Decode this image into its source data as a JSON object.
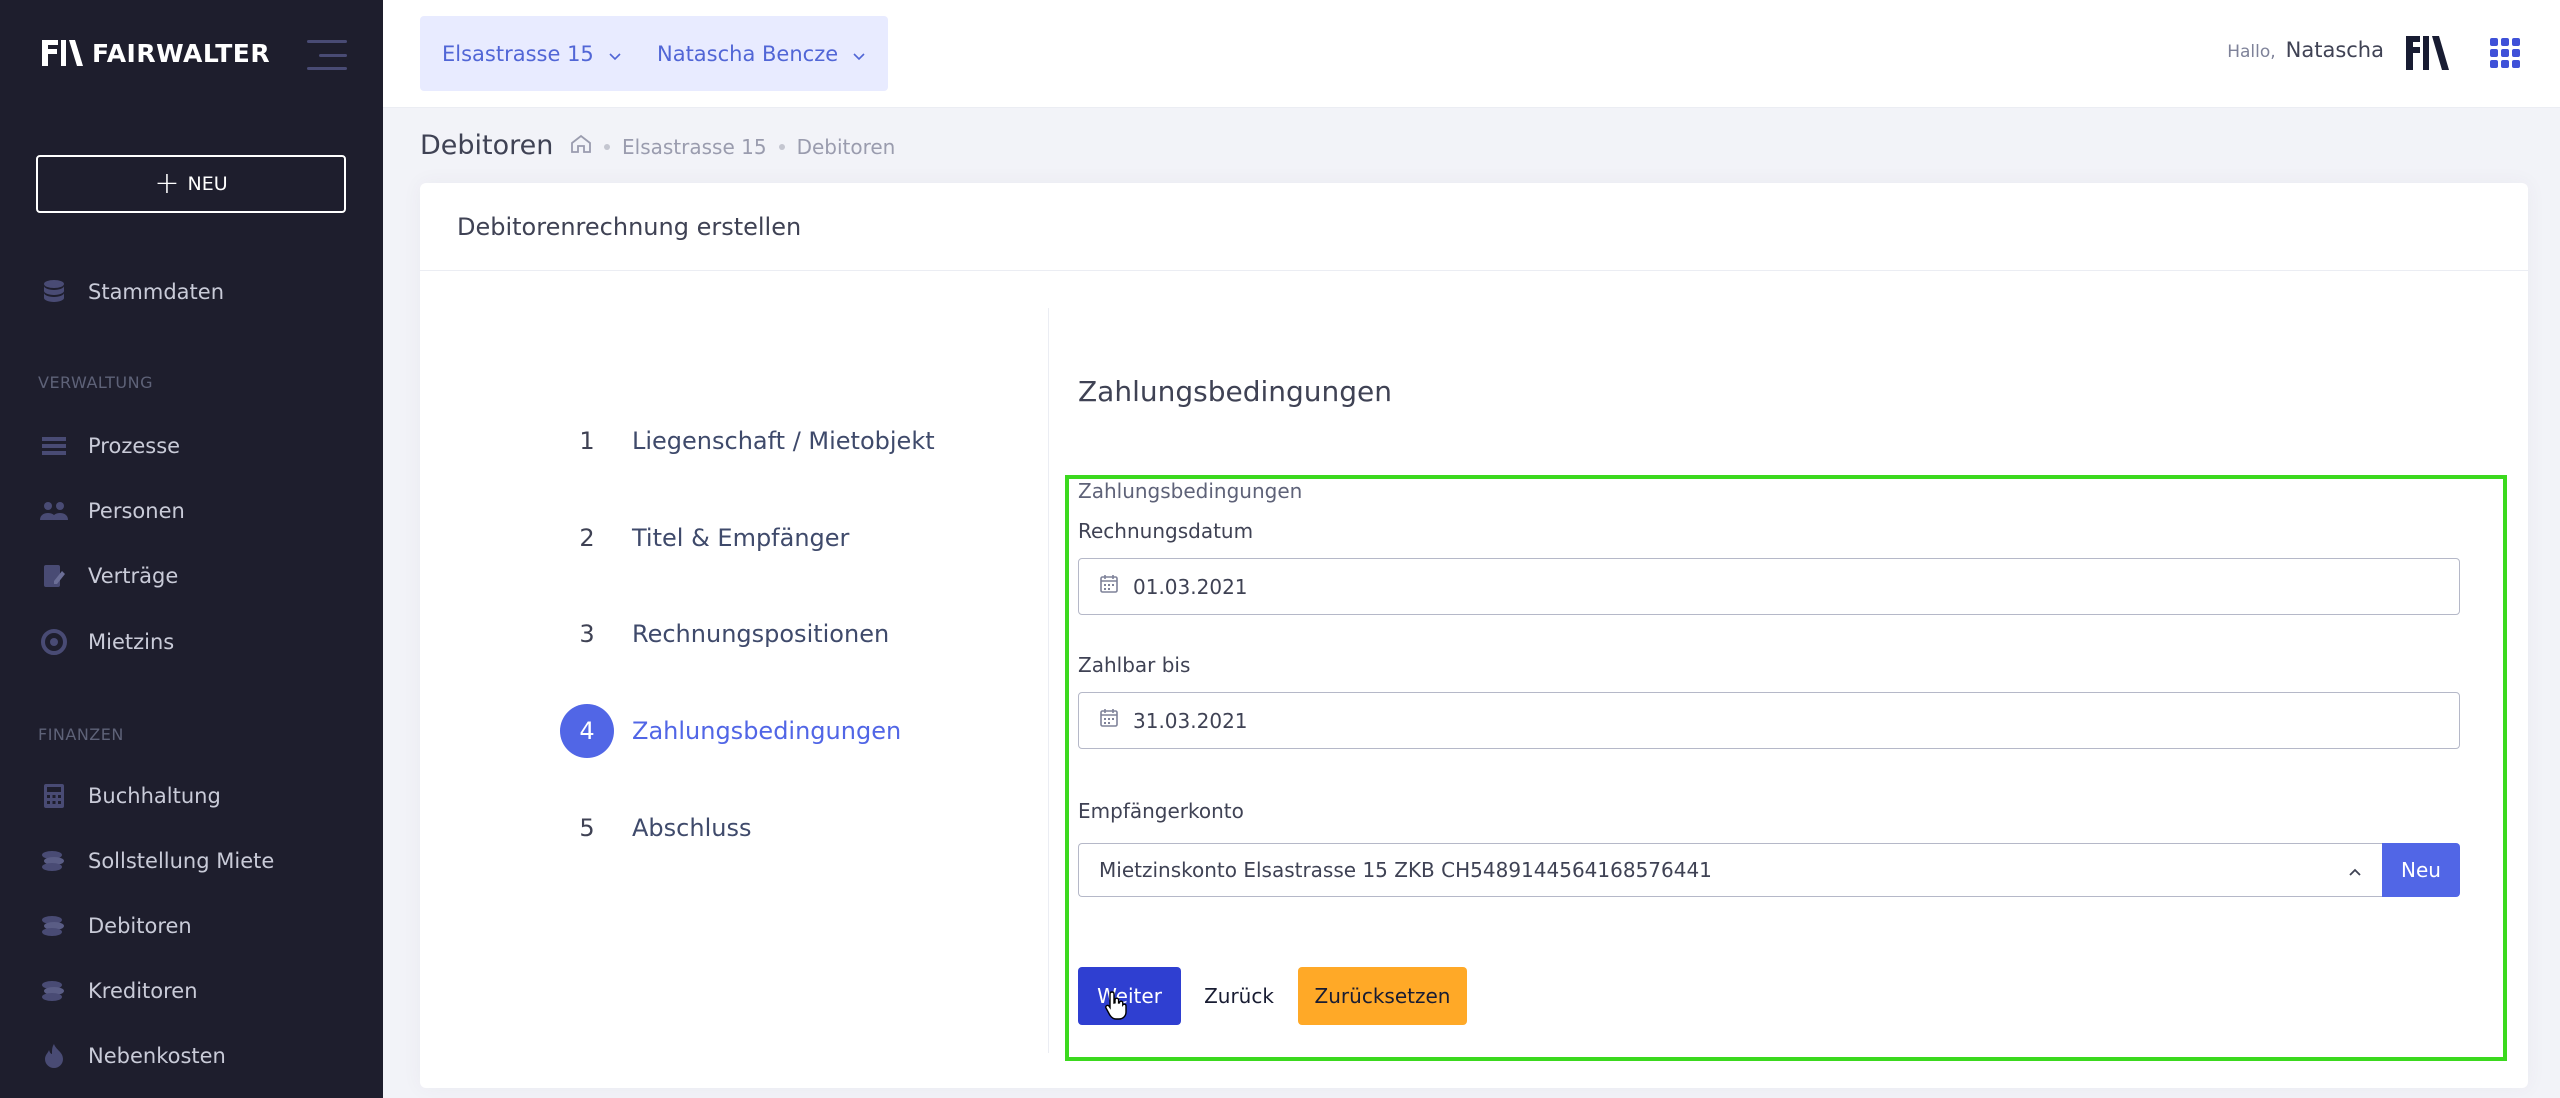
{
  "app": {
    "brand": "FAIRWALTER",
    "new_button": "NEU"
  },
  "sidebar": {
    "top_items": [
      {
        "label": "Stammdaten",
        "icon": "database-icon"
      }
    ],
    "sections": [
      {
        "title": "VERWALTUNG",
        "items": [
          {
            "label": "Prozesse",
            "icon": "process-icon"
          },
          {
            "label": "Personen",
            "icon": "people-icon"
          },
          {
            "label": "Verträge",
            "icon": "contract-icon"
          },
          {
            "label": "Mietzins",
            "icon": "rent-icon"
          }
        ]
      },
      {
        "title": "FINANZEN",
        "items": [
          {
            "label": "Buchhaltung",
            "icon": "calculator-icon"
          },
          {
            "label": "Sollstellung Miete",
            "icon": "coins-icon"
          },
          {
            "label": "Debitoren",
            "icon": "coins-icon"
          },
          {
            "label": "Kreditoren",
            "icon": "coins-icon"
          },
          {
            "label": "Nebenkosten",
            "icon": "flame-icon"
          }
        ]
      }
    ]
  },
  "topbar": {
    "property_select": "Elsastrasse 15",
    "user_select": "Natascha Bencze",
    "greeting": "Hallo,",
    "user_name": "Natascha"
  },
  "subheader": {
    "title": "Debitoren",
    "breadcrumb": [
      "Elsastrasse 15",
      "Debitoren"
    ]
  },
  "card": {
    "title": "Debitorenrechnung erstellen",
    "steps": [
      {
        "number": "1",
        "label": "Liegenschaft / Mietobjekt",
        "active": false
      },
      {
        "number": "2",
        "label": "Titel & Empfänger",
        "active": false
      },
      {
        "number": "3",
        "label": "Rechnungspositionen",
        "active": false
      },
      {
        "number": "4",
        "label": "Zahlungsbedingungen",
        "active": true
      },
      {
        "number": "5",
        "label": "Abschluss",
        "active": false
      }
    ],
    "section_title": "Zahlungsbedingungen",
    "form": {
      "group_label": "Zahlungsbedingungen",
      "invoice_date_label": "Rechnungsdatum",
      "invoice_date_value": "01.03.2021",
      "due_date_label": "Zahlbar bis",
      "due_date_value": "31.03.2021",
      "account_label": "Empfängerkonto",
      "account_value": "Mietzinskonto Elsastrasse 15 ZKB CH5489144564168576441",
      "account_new_button": "Neu"
    },
    "buttons": {
      "next": "Weiter",
      "back": "Zurück",
      "reset": "Zurücksetzen"
    }
  },
  "colors": {
    "sidebar_bg": "#1e1e2d",
    "primary": "#5166e6",
    "warning": "#ffa927",
    "highlight_frame": "#3bd91e"
  }
}
